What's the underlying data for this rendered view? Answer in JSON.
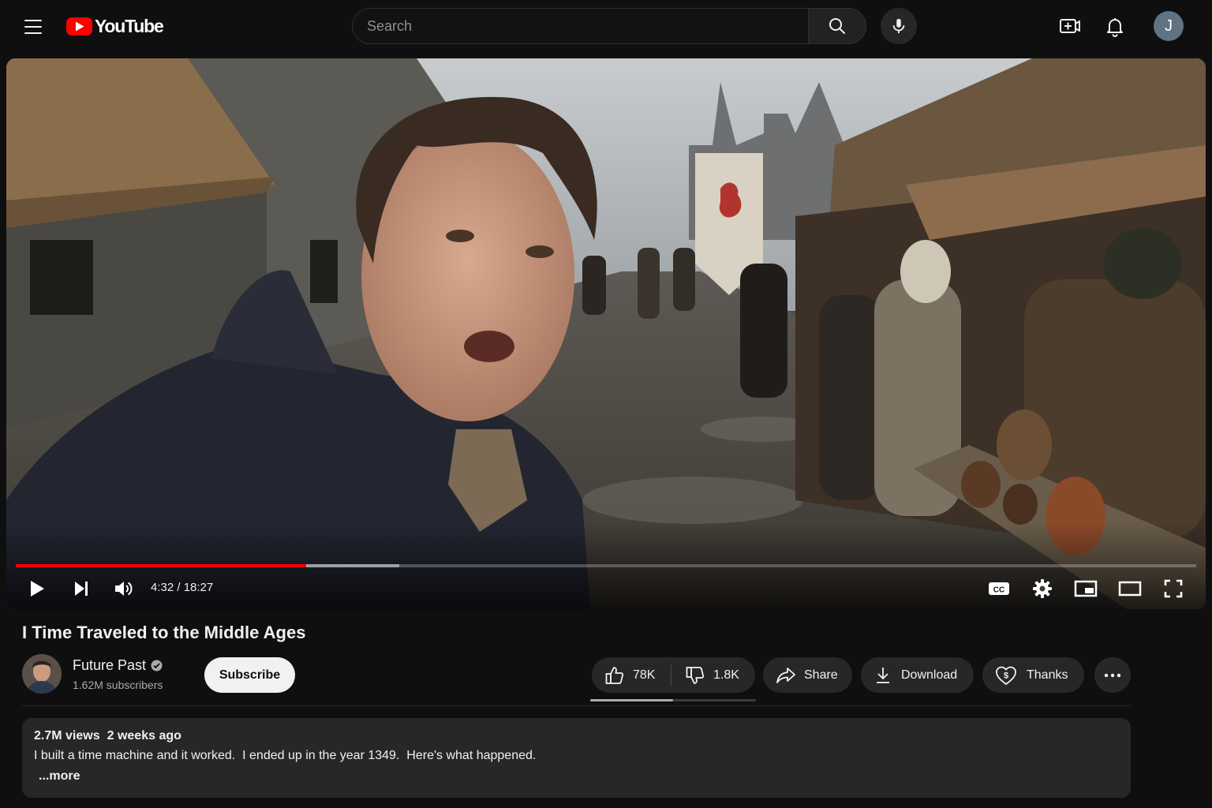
{
  "header": {
    "logo_text": "YouTube",
    "search": {
      "placeholder": "Search",
      "value": ""
    },
    "avatar_initial": "J"
  },
  "player": {
    "time_display": "4:32 / 18:27",
    "current_time": "4:32",
    "duration": "18:27",
    "progress_fraction": 0.246,
    "buffered_fraction": 0.325,
    "captions_label": "CC"
  },
  "video": {
    "title": "I Time Traveled to the Middle Ages",
    "channel": {
      "name": "Future Past",
      "verified": true,
      "subscribers": "1.62M subscribers"
    },
    "subscribe_label": "Subscribe",
    "likes": "78K",
    "dislikes": "1.8K",
    "like_ratio_fraction": 0.5,
    "share_label": "Share",
    "download_label": "Download",
    "thanks_label": "Thanks"
  },
  "description": {
    "views": "2.7M views",
    "uploaded": "2 weeks ago",
    "text": "I built a time machine and it worked.  I ended up in the year 1349.  Here's what happened.",
    "more_label": "...more"
  },
  "colors": {
    "brand_red": "#ff0000",
    "background": "#0f0f0f",
    "pill_bg": "#272727",
    "avatar_bg": "#5f7383"
  },
  "icons": [
    "menu-icon",
    "youtube-logo-icon",
    "search-icon",
    "mic-icon",
    "create-icon",
    "bell-icon",
    "play-icon",
    "next-icon",
    "volume-icon",
    "captions-icon",
    "settings-icon",
    "miniplayer-icon",
    "theater-icon",
    "fullscreen-icon",
    "verified-icon",
    "thumbs-up-icon",
    "thumbs-down-icon",
    "share-icon",
    "download-icon",
    "thanks-icon",
    "more-icon"
  ]
}
